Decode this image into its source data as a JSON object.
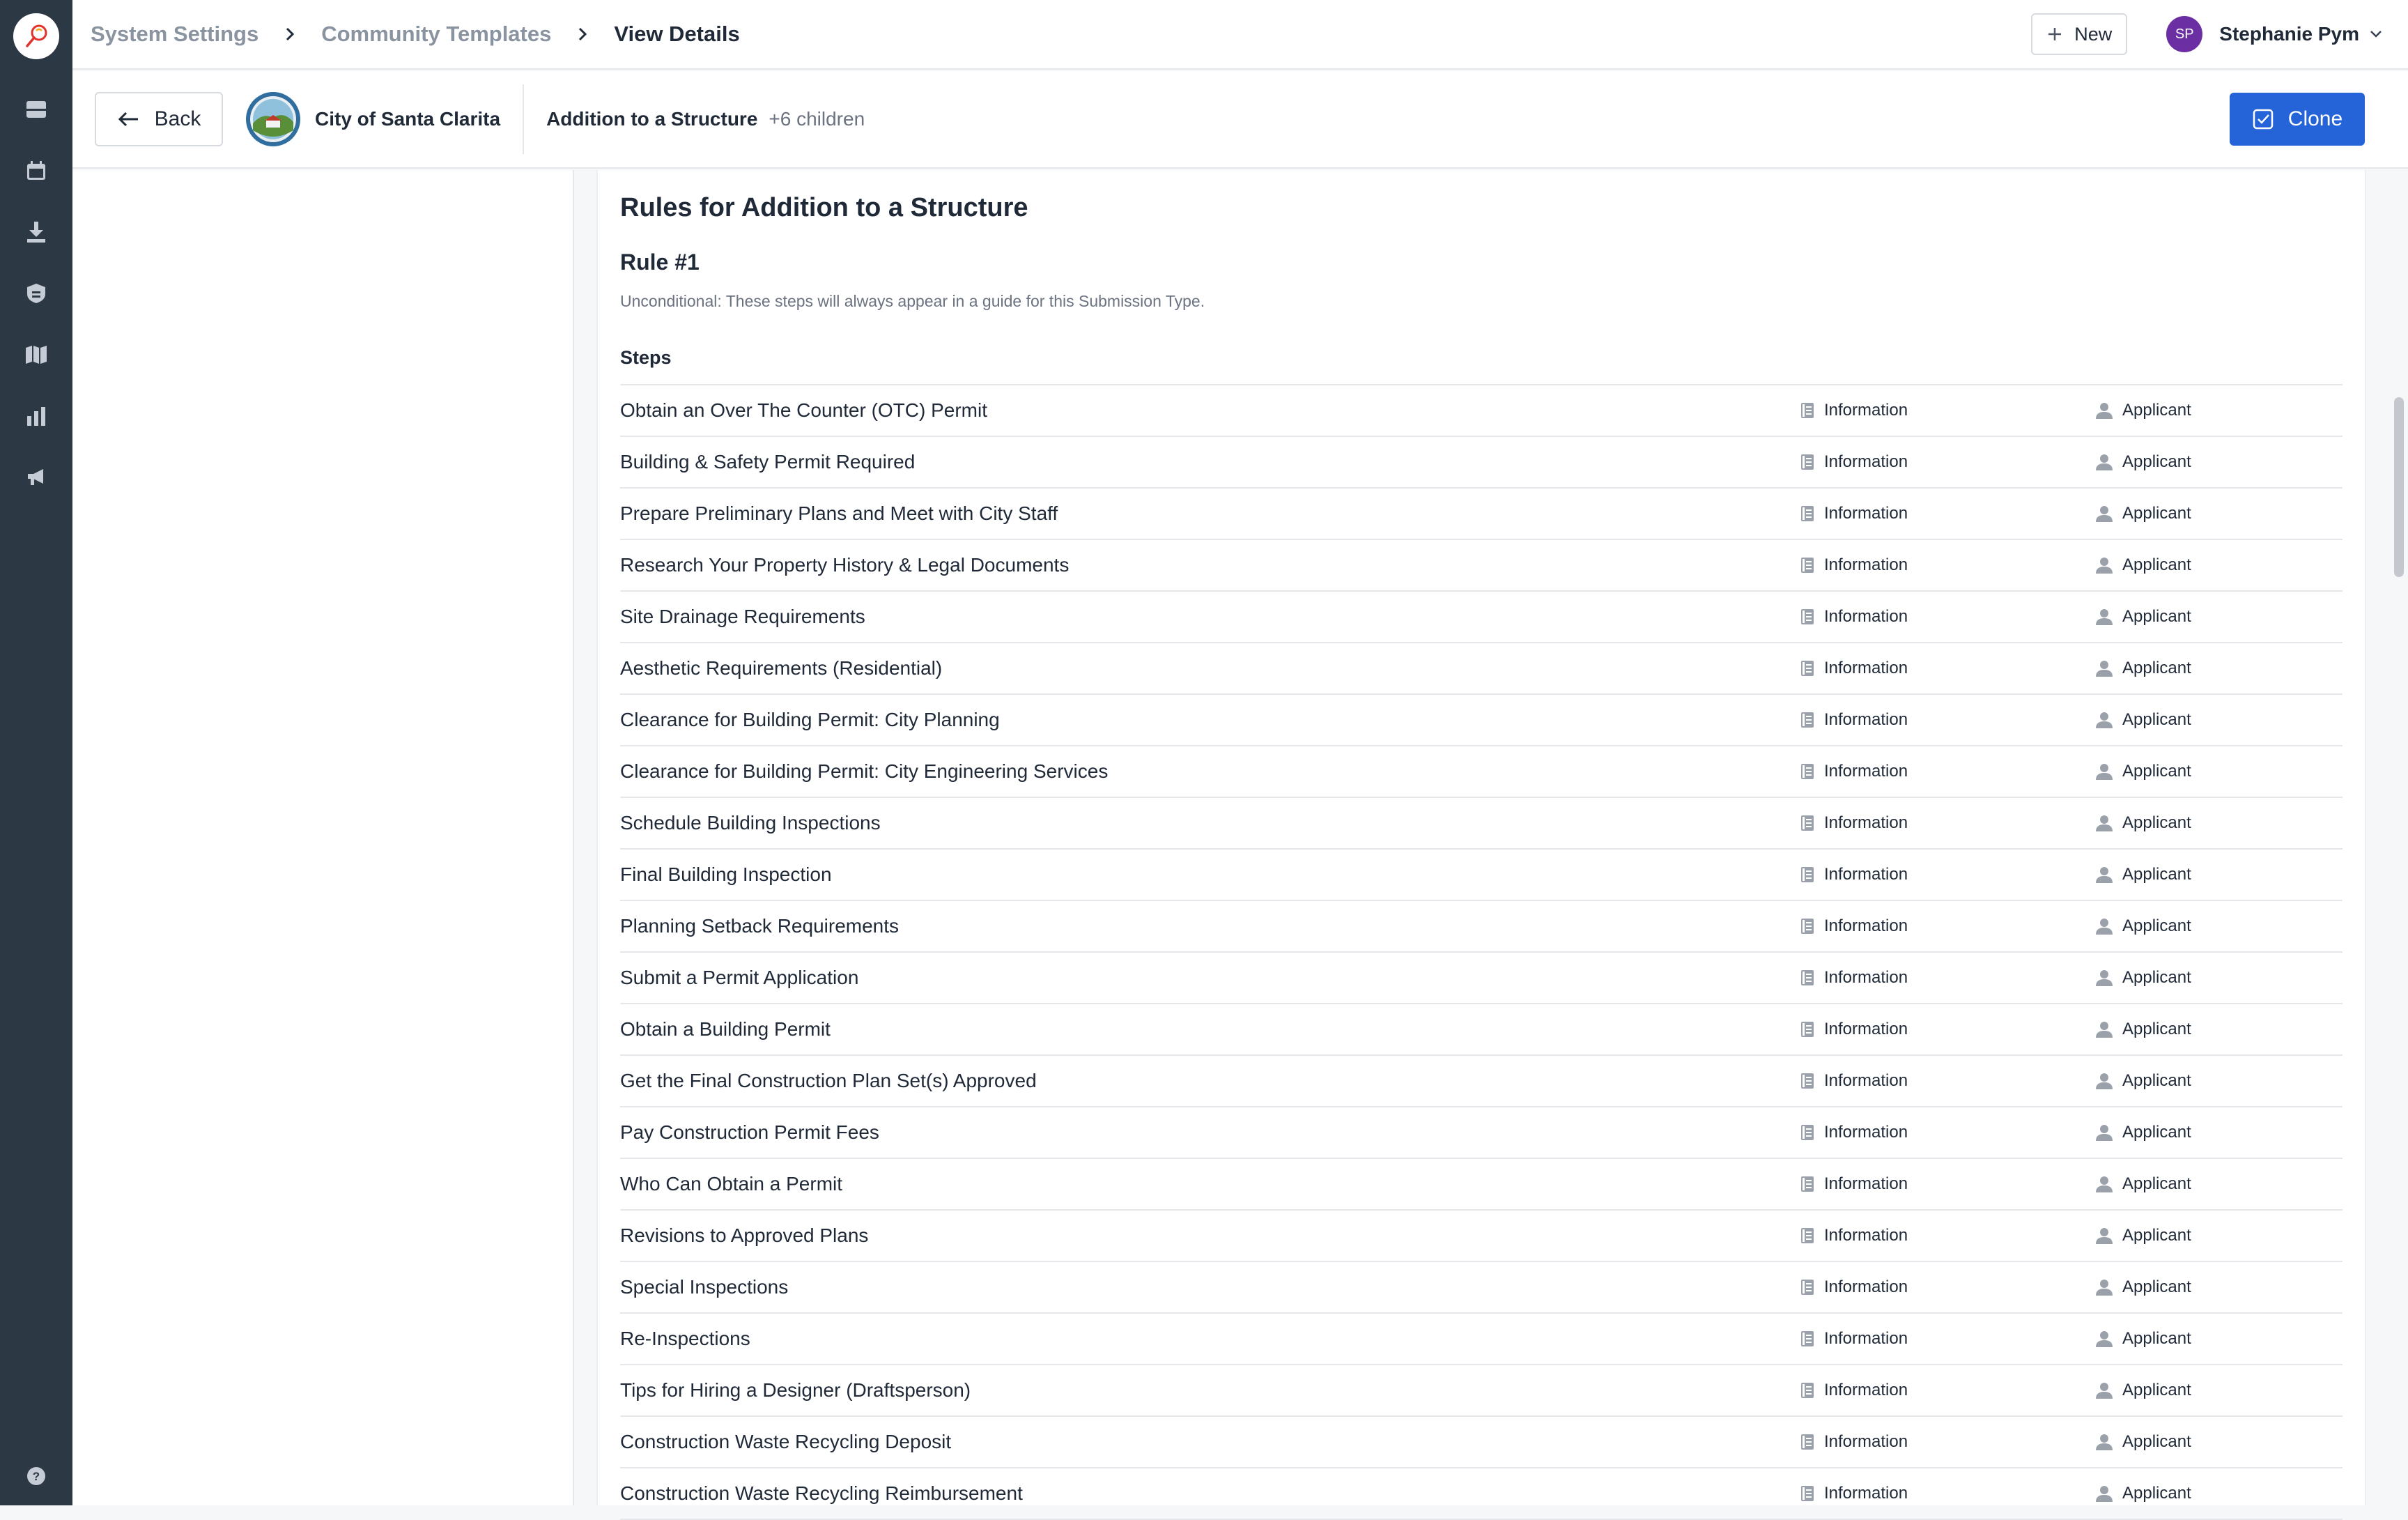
{
  "nav": {
    "icons": [
      "inbox-icon",
      "calendar-icon",
      "download-icon",
      "badge-icon",
      "map-icon",
      "chart-icon",
      "megaphone-icon"
    ],
    "help_icon": "help-icon"
  },
  "breadcrumb": {
    "items": [
      "System Settings",
      "Community Templates",
      "View Details"
    ]
  },
  "topbar": {
    "new_label": "New",
    "user_initials": "SP",
    "user_name": "Stephanie Pym"
  },
  "subheader": {
    "back_label": "Back",
    "city_name": "City of Santa Clarita",
    "title": "Addition to a Structure",
    "children": "+6 children",
    "clone_label": "Clone"
  },
  "colors": {
    "rail": "#2d3845",
    "accent": "#2563d8",
    "avatar": "#6b2fa3"
  },
  "rules": {
    "title": "Rules for Addition to a Structure",
    "rule_number": "Rule #1",
    "description": "Unconditional: These steps will always appear in a guide for this Submission Type.",
    "steps_label": "Steps",
    "steps": [
      {
        "name": "Obtain an Over The Counter (OTC) Permit",
        "type": "Information",
        "role": "Applicant"
      },
      {
        "name": "Building & Safety Permit Required",
        "type": "Information",
        "role": "Applicant"
      },
      {
        "name": "Prepare Preliminary Plans and Meet with City Staff",
        "type": "Information",
        "role": "Applicant"
      },
      {
        "name": "Research Your Property History & Legal Documents",
        "type": "Information",
        "role": "Applicant"
      },
      {
        "name": "Site Drainage Requirements",
        "type": "Information",
        "role": "Applicant"
      },
      {
        "name": "Aesthetic Requirements (Residential)",
        "type": "Information",
        "role": "Applicant"
      },
      {
        "name": "Clearance for Building Permit: City Planning",
        "type": "Information",
        "role": "Applicant"
      },
      {
        "name": "Clearance for Building Permit: City Engineering Services",
        "type": "Information",
        "role": "Applicant"
      },
      {
        "name": "Schedule Building Inspections",
        "type": "Information",
        "role": "Applicant"
      },
      {
        "name": "Final Building Inspection",
        "type": "Information",
        "role": "Applicant"
      },
      {
        "name": "Planning Setback Requirements",
        "type": "Information",
        "role": "Applicant"
      },
      {
        "name": "Submit a Permit Application",
        "type": "Information",
        "role": "Applicant"
      },
      {
        "name": "Obtain a Building Permit",
        "type": "Information",
        "role": "Applicant"
      },
      {
        "name": "Get the Final Construction Plan Set(s) Approved",
        "type": "Information",
        "role": "Applicant"
      },
      {
        "name": "Pay Construction Permit Fees",
        "type": "Information",
        "role": "Applicant"
      },
      {
        "name": "Who Can Obtain a Permit",
        "type": "Information",
        "role": "Applicant"
      },
      {
        "name": "Revisions to Approved Plans",
        "type": "Information",
        "role": "Applicant"
      },
      {
        "name": "Special Inspections",
        "type": "Information",
        "role": "Applicant"
      },
      {
        "name": "Re-Inspections",
        "type": "Information",
        "role": "Applicant"
      },
      {
        "name": "Tips for Hiring a Designer (Draftsperson)",
        "type": "Information",
        "role": "Applicant"
      },
      {
        "name": "Construction Waste Recycling Deposit",
        "type": "Information",
        "role": "Applicant"
      },
      {
        "name": "Construction Waste Recycling Reimbursement",
        "type": "Information",
        "role": "Applicant"
      }
    ]
  }
}
